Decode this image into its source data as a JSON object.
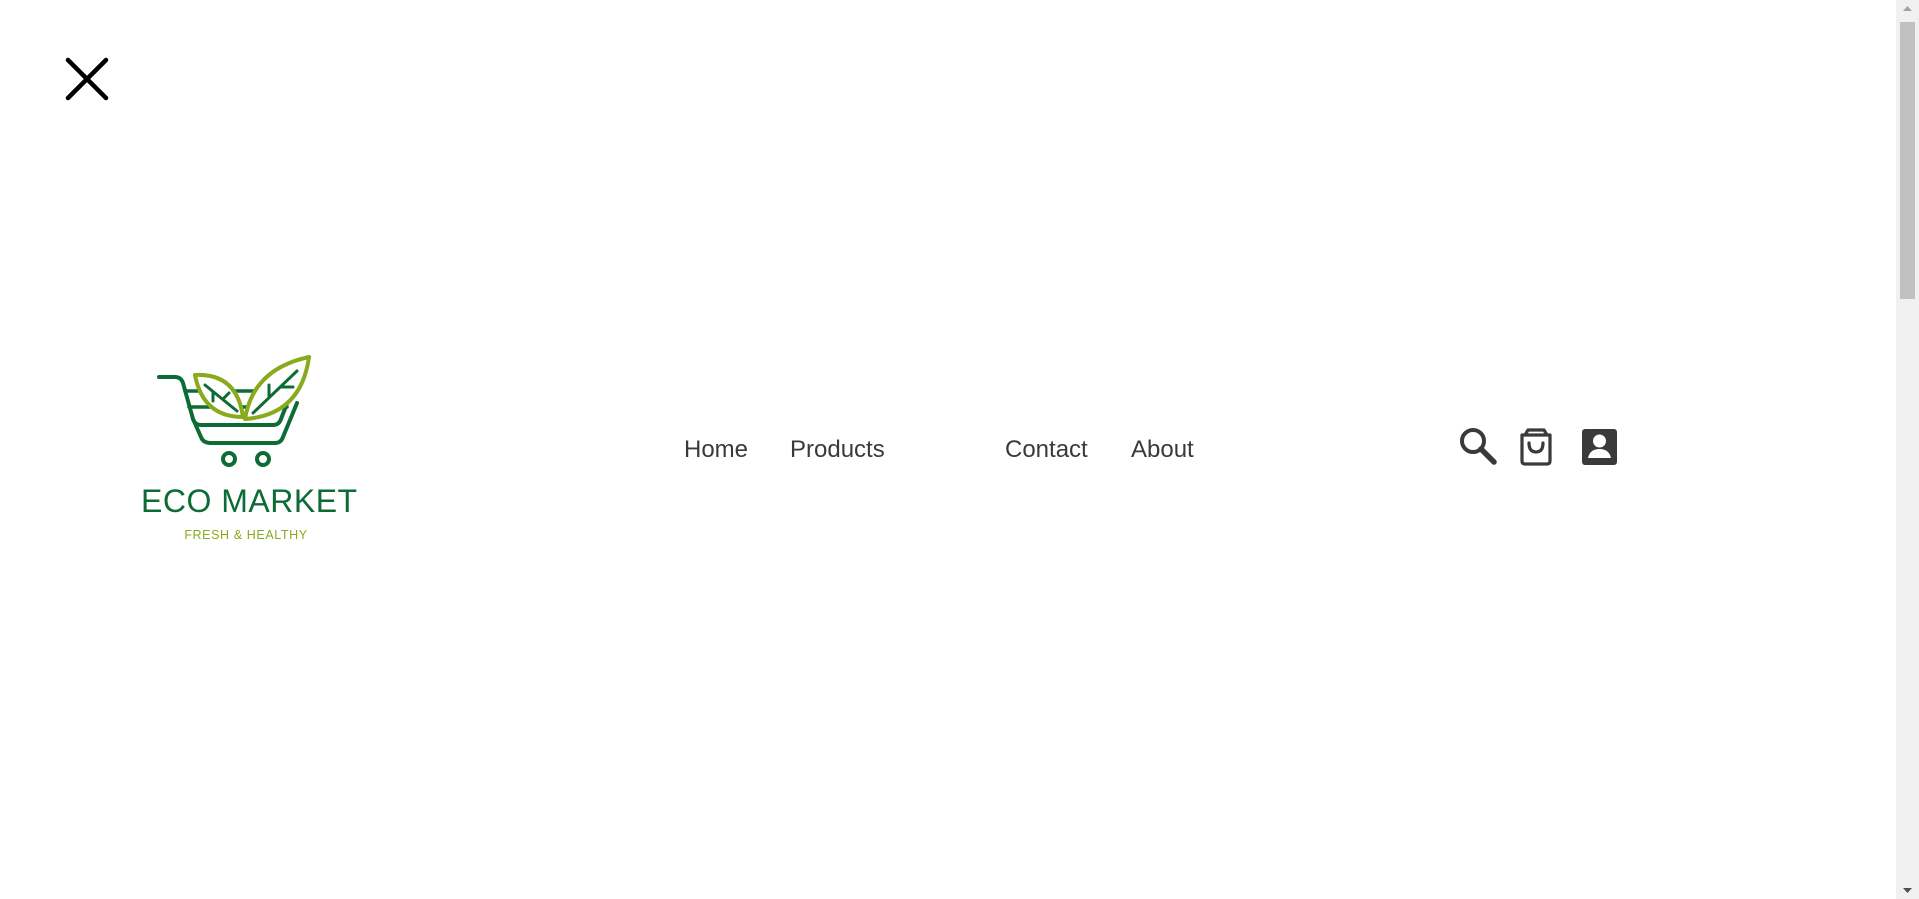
{
  "menu": {
    "close_icon": "close-icon"
  },
  "brand": {
    "name": "ECO MARKET",
    "tagline": "FRESH & HEALTHY",
    "primary_color": "#0d6b35",
    "accent_color": "#8aaa1e"
  },
  "nav": {
    "items": [
      {
        "label": "Home"
      },
      {
        "label": "Products"
      },
      {
        "label": "Contact"
      },
      {
        "label": "About"
      }
    ]
  },
  "header_icons": {
    "search": "search-icon",
    "cart": "shopping-bag-icon",
    "account": "account-icon",
    "color": "#3a3a3a"
  }
}
